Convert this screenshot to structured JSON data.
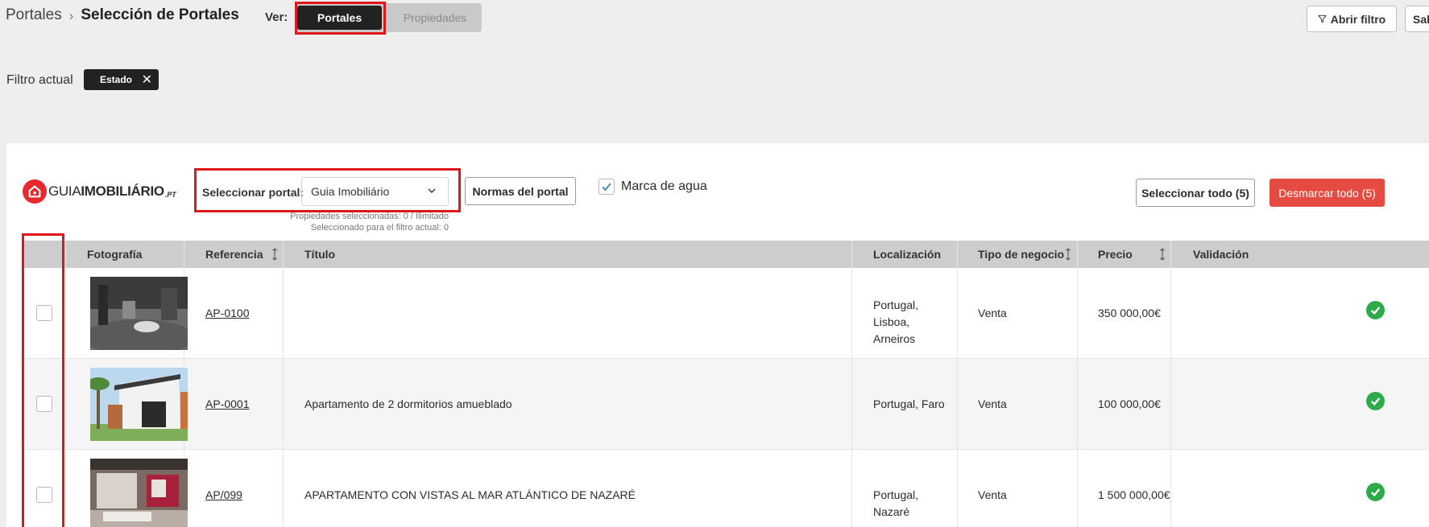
{
  "breadcrumb": {
    "parent": "Portales",
    "current": "Selección de Portales"
  },
  "view": {
    "label": "Ver:",
    "options": [
      "Portales",
      "Propiedades"
    ],
    "active": "Portales"
  },
  "header_buttons": {
    "filter": "Abrir filtro",
    "exit": "Salir"
  },
  "filter": {
    "label": "Filtro actual",
    "chip": "Estado",
    "chip_close": "✕"
  },
  "portal": {
    "logo_prefix": "GUIA",
    "logo_bold": "IMOBILIÁRIO",
    "logo_tld": ".PT",
    "select_label": "Seleccionar portal:",
    "selected": "Guia Imobiliário",
    "note_selected": "Propiedades seleccionadas: 0 / Ilimitado",
    "note_filter": "Seleccionado para el filtro actual: 0",
    "rules_button": "Normas del portal",
    "watermark_label": "Marca de agua",
    "watermark_checked": true,
    "select_all": "Seleccionar todo (5)",
    "deselect_all": "Desmarcar todo (5)"
  },
  "table": {
    "columns": [
      "Fotografía",
      "Referencia",
      "Título",
      "Localización",
      "Tipo de negocio",
      "Precio",
      "Validación"
    ],
    "rows": [
      {
        "ref": "AP-0100",
        "title": "",
        "location": "Portugal, Lisboa, Arneiros",
        "business": "Venta",
        "price": "350 000,00€",
        "valid": true
      },
      {
        "ref": "AP-0001",
        "title": "Apartamento de 2 dormitorios amueblado",
        "location": "Portugal, Faro",
        "business": "Venta",
        "price": "100 000,00€",
        "valid": true
      },
      {
        "ref": "AP/099",
        "title": "APARTAMENTO CON VISTAS AL MAR ATLÁNTICO DE NAZARÉ",
        "location": "Portugal, Nazaré",
        "business": "Venta",
        "price": "1 500 000,00€",
        "valid": true
      }
    ]
  },
  "colors": {
    "highlight": "#e0161d",
    "danger_button": "#e54b40",
    "valid": "#2eaa4b",
    "brand": "#e8282e"
  }
}
